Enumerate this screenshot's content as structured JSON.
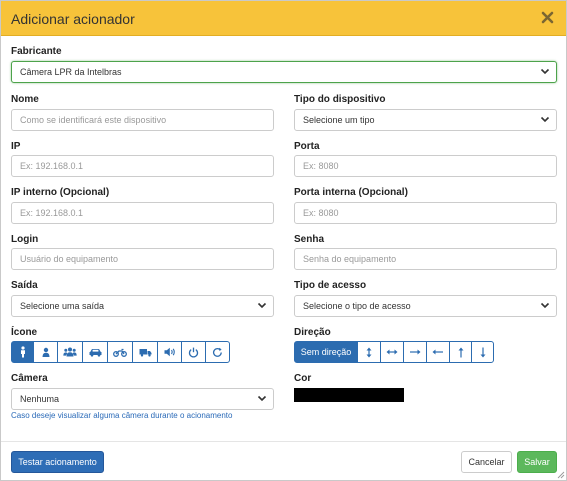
{
  "modal": {
    "title": "Adicionar acionador"
  },
  "form": {
    "manufacturer": {
      "label": "Fabricante",
      "value": "Câmera LPR da Intelbras"
    },
    "name": {
      "label": "Nome",
      "placeholder": "Como se identificará este dispositivo"
    },
    "device_type": {
      "label": "Tipo do dispositivo",
      "value": "Selecione um tipo"
    },
    "ip": {
      "label": "IP",
      "placeholder": "Ex: 192.168.0.1"
    },
    "port": {
      "label": "Porta",
      "placeholder": "Ex: 8080"
    },
    "internal_ip": {
      "label": "IP interno (Opcional)",
      "placeholder": "Ex: 192.168.0.1"
    },
    "internal_port": {
      "label": "Porta interna (Opcional)",
      "placeholder": "Ex: 8080"
    },
    "login": {
      "label": "Login",
      "placeholder": "Usuário do equipamento"
    },
    "password": {
      "label": "Senha",
      "placeholder": "Senha do equipamento"
    },
    "output": {
      "label": "Saída",
      "value": "Selecione uma saída"
    },
    "access_type": {
      "label": "Tipo de acesso",
      "value": "Selecione o tipo de acesso"
    },
    "icon": {
      "label": "Ícone",
      "options": [
        "person-icon",
        "user-icon",
        "group-icon",
        "car-icon",
        "motorcycle-icon",
        "truck-icon",
        "speaker-icon",
        "power-icon",
        "refresh-icon"
      ],
      "selected": "person-icon"
    },
    "direction": {
      "label": "Direção",
      "no_direction_label": "Sem direção",
      "options": [
        "vertical-both-arrow-icon",
        "horizontal-both-arrow-icon",
        "arrow-right-icon",
        "arrow-left-icon",
        "arrow-up-icon",
        "arrow-down-icon"
      ],
      "selected": "Sem direção"
    },
    "camera": {
      "label": "Câmera",
      "value": "Nenhuma",
      "help": "Caso deseje visualizar alguma câmera durante o acionamento"
    },
    "color": {
      "label": "Cor",
      "value": "#000000"
    }
  },
  "footer": {
    "test_label": "Testar acionamento",
    "cancel_label": "Cancelar",
    "save_label": "Salvar"
  },
  "colors": {
    "header": "#f7c33a",
    "primary": "#2e6db6",
    "success": "#5cb85c"
  }
}
